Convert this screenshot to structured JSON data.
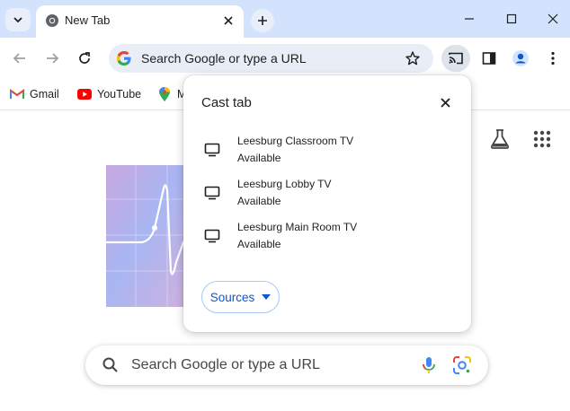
{
  "tab": {
    "title": "New Tab"
  },
  "omnibox": {
    "text": "Search Google or type a URL"
  },
  "bookmarks": [
    {
      "label": "Gmail",
      "icon": "gmail-icon"
    },
    {
      "label": "YouTube",
      "icon": "youtube-icon"
    },
    {
      "label": "M",
      "icon": "maps-icon"
    }
  ],
  "ntp_search": {
    "text": "Search Google or type a URL"
  },
  "cast": {
    "title": "Cast tab",
    "sinks": [
      {
        "name": "Leesburg Classroom TV",
        "status": "Available"
      },
      {
        "name": "Leesburg Lobby TV",
        "status": "Available"
      },
      {
        "name": "Leesburg Main Room TV",
        "status": "Available"
      }
    ],
    "sources_label": "Sources"
  },
  "colors": {
    "tabstrip": "#d3e3fd",
    "omnibox": "#e9eef6",
    "accent": "#0b57d0"
  }
}
